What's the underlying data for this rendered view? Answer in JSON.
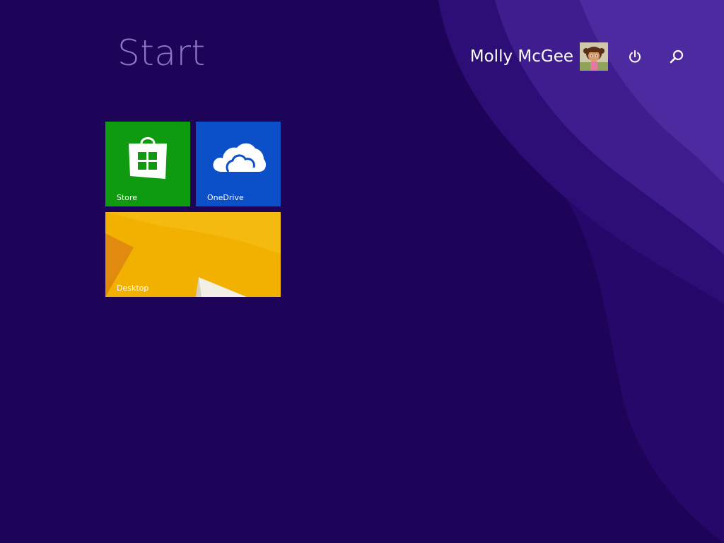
{
  "screen": {
    "title": "Start",
    "background_color": "#1e0458"
  },
  "user": {
    "name": "Molly McGee",
    "avatar_icon": "user-avatar"
  },
  "top_icons": {
    "power": "power-icon",
    "search": "search-icon"
  },
  "tiles": [
    {
      "label": "Store",
      "icon": "store-bag-icon",
      "color": "#0f9b0f"
    },
    {
      "label": "OneDrive",
      "icon": "cloud-icon",
      "color": "#0b50c8"
    },
    {
      "label": "Desktop",
      "icon": "desktop-wallpaper",
      "color": "#f2b000"
    }
  ]
}
